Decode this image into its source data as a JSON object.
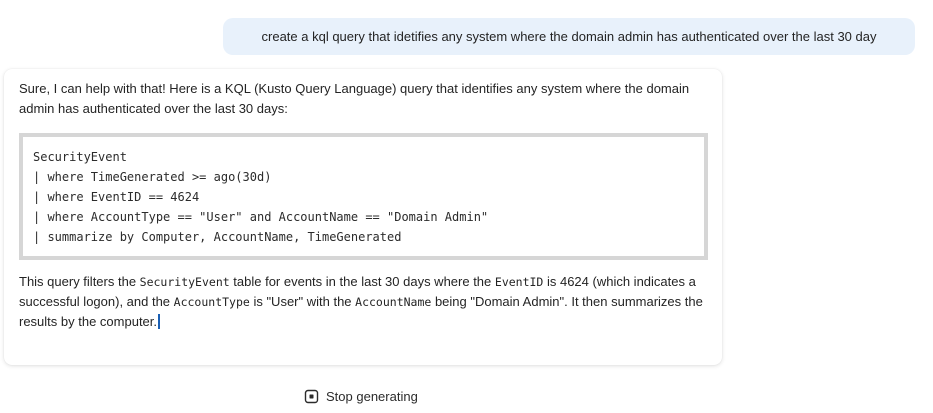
{
  "user_message": {
    "text": "create a kql query that idetifies any system where the domain admin has authenticated over the last 30 day"
  },
  "response": {
    "intro": "Sure, I can help with that! Here is a KQL (Kusto Query Language) query that identifies any system where the domain admin has authenticated over the last 30 days:",
    "code_lines": [
      "SecurityEvent",
      "| where TimeGenerated >= ago(30d)",
      "| where EventID == 4624",
      "| where AccountType == \"User\" and AccountName == \"Domain Admin\"",
      "| summarize by Computer, AccountName, TimeGenerated"
    ],
    "outro": {
      "t1": "This query filters the ",
      "c1": "SecurityEvent",
      "t2": " table for events in the last 30 days where the ",
      "c2": "EventID",
      "t3": " is 4624 (which indicates a successful logon), and the ",
      "c3": "AccountType",
      "t4": " is \"User\" with the ",
      "c4": "AccountName",
      "t5": " being \"Domain Admin\". It then summarizes the results by the computer."
    }
  },
  "controls": {
    "stop_label": "Stop generating",
    "stop_icon": "stop-square-icon"
  }
}
